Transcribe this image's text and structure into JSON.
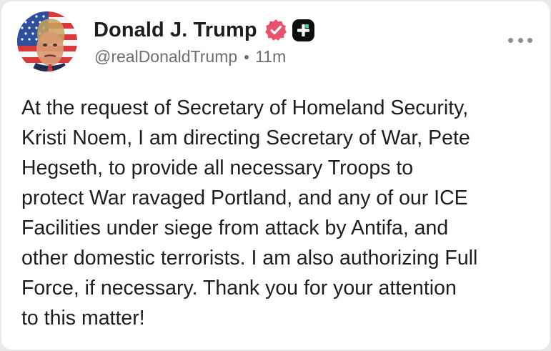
{
  "author": {
    "display_name": "Donald J. Trump",
    "handle": "@realDonaldTrump",
    "timestamp": "11m",
    "avatar_icon": "flag-portrait-avatar",
    "verified_icon": "verified-badge-icon",
    "plus_icon": "plus-badge-icon"
  },
  "post": {
    "text": "At the request of Secretary of Homeland Security,\nKristi Noem, I am directing Secretary of War, Pete\nHegseth, to provide all necessary Troops to\nprotect War ravaged Portland, and any of our ICE\nFacilities under siege from attack by Antifa, and\nother domestic terrorists. I am also authorizing Full\nForce, if necessary. Thank you for your attention\nto this matter!"
  },
  "menu": {
    "icon": "more-options-icon"
  },
  "colors": {
    "verified": "#e8536b",
    "plus_badge": "#0f0f10",
    "plus_accent": "#2ee59d",
    "text": "#1d1d1f",
    "muted": "#6e6e73"
  }
}
